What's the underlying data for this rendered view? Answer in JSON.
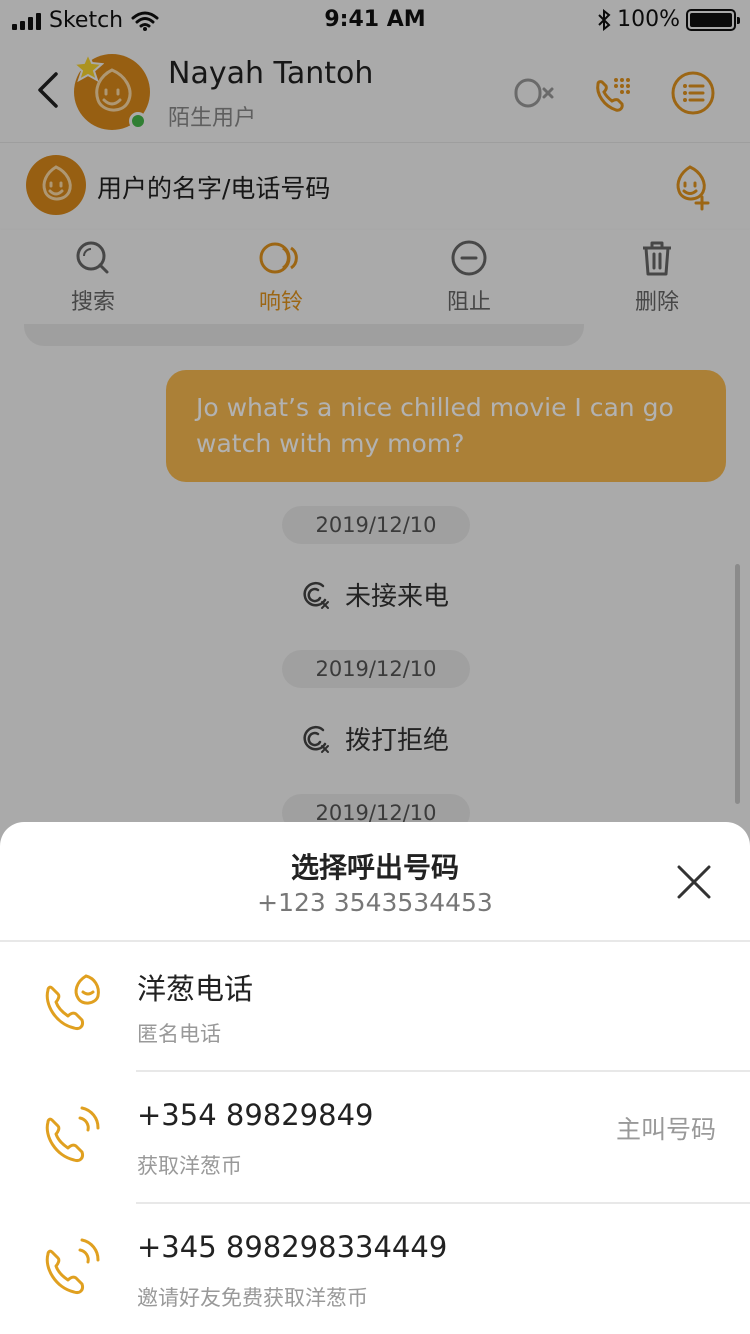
{
  "status_bar": {
    "carrier": "Sketch",
    "time": "9:41 AM",
    "battery": "100%"
  },
  "header": {
    "name": "Nayah Tantoh",
    "subtitle": "陌生用户"
  },
  "contact_bar": {
    "text": "用户的名字/电话号码"
  },
  "actions": [
    {
      "label": "搜索",
      "icon": "search-icon"
    },
    {
      "label": "响铃",
      "icon": "ring-icon"
    },
    {
      "label": "阻止",
      "icon": "block-icon"
    },
    {
      "label": "删除",
      "icon": "trash-icon"
    }
  ],
  "chat": {
    "message": "Jo what’s a nice chilled movie I can go watch with my mom?",
    "entries": [
      {
        "date": "2019/12/10",
        "event": "未接来电"
      },
      {
        "date": "2019/12/10",
        "event": "拨打拒绝"
      },
      {
        "date": "2019/12/10"
      }
    ]
  },
  "sheet": {
    "title": "选择呼出号码",
    "number": "+123 3543534453",
    "options": [
      {
        "title": "洋葱电话",
        "subtitle": "匿名电话",
        "tag": ""
      },
      {
        "title": "+354 89829849",
        "subtitle": "获取洋葱币",
        "tag": "主叫号码"
      },
      {
        "title": "+345 898298334449",
        "subtitle": "邀请好友免费获取洋葱币",
        "tag": ""
      }
    ]
  },
  "colors": {
    "accent": "#e0931e",
    "avatar": "#d8891a",
    "bubble": "#f5b84f",
    "online": "#45b649"
  }
}
